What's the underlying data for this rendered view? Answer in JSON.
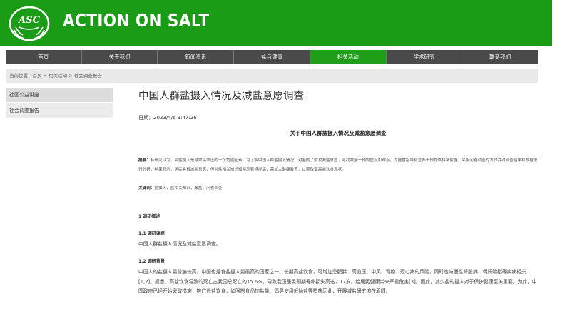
{
  "header": {
    "logo_text": "ASC",
    "brand": "ACTION ON SALT",
    "brand_color": "#1a9c16"
  },
  "nav": {
    "items": [
      {
        "label": "首页"
      },
      {
        "label": "关于我们"
      },
      {
        "label": "新闻资讯"
      },
      {
        "label": "盐与健康"
      },
      {
        "label": "相关活动"
      },
      {
        "label": "学术研究"
      },
      {
        "label": "联系我们"
      }
    ],
    "active_index": 4
  },
  "breadcrumb": {
    "prefix": "当前位置：",
    "home": "首页",
    "sep": " > ",
    "section": "相关活动",
    "page": "社会调查报告"
  },
  "sidebar": {
    "items": [
      {
        "label": "社区公益讲座"
      },
      {
        "label": "社会调查报告"
      }
    ]
  },
  "article": {
    "title": "中国人群盐摄入情况及减盐意愿调查",
    "date_label": "日期：",
    "date": "2023/4/6 9:47:26",
    "doc_title": "关于中国人群盐摄入情况及减盐意愿调查",
    "abstract_label": "摘要：",
    "abstract": "有研究认为，高盐摄入是导致高血压的一个危险因素。为了解中国人群盐摄入情况、对盐的了解及减盐意愿，寻找减盐干预的重点和难点，为膳食指导和营养干预提供科学依据，采用问卷调查的方式并对调查结果和数据进行分析，结果显示，居民具有减盐意愿，但对盐相关知识知晓率有待提高，需加大健康教育，以期改变高盐饮食现状。",
    "keywords_label": "关键词：",
    "keywords": "盐摄入，盐相关知识，减盐，问卷调查",
    "section1": "1 调研概述",
    "section1_1": "1.1 调研课题",
    "section1_1_text": "中国人群盐摄入情况及减盐意愿调查。",
    "section1_2": "1.2 调研背景",
    "section1_2_text": "中国人的盐摄入量普遍较高，中国也是食盐摄入量最高的国家之一。长期高盐饮食，可增加患肥胖、高血压、中风、胃癌、冠心病的风险，同时也与慢性肾脏病、骨质疏松等疾病相关[1,2]。据悉，高盐饮食导致的死亡占我国总死亡的15.6%，导致我国居民预期寿命损失高达2.17岁，给居民健康带来严重危害[3]。因此，减少盐的摄入对于保护健康至关重要。为此，中国政府已经开始采取措施，推广低盐饮食，如限制食品加盐量、倡导使用低钠盐等措施因此，开展减盐研究迫在眉睫。"
  }
}
